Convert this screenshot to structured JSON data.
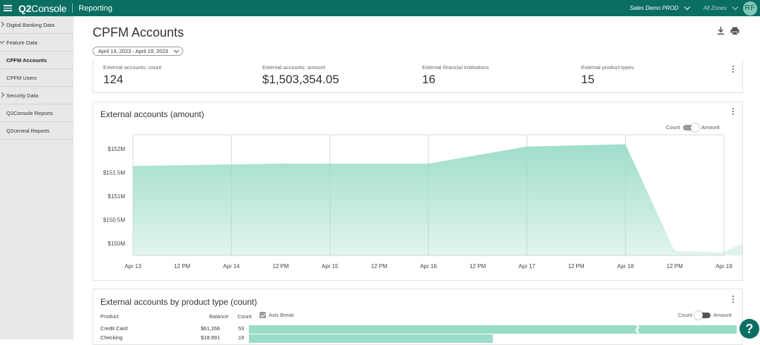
{
  "header": {
    "logo_main": "Q2",
    "logo_light": "Console",
    "section": "Reporting",
    "environment": "Sales Demo PROD",
    "zones": "All Zones",
    "avatar_initials": "RF"
  },
  "sidebar": {
    "items": [
      {
        "label": "Digital Banking Data",
        "caret": "right"
      },
      {
        "label": "Feature Data",
        "caret": "down"
      },
      {
        "label": "CPFM Accounts",
        "caret": "",
        "active": true
      },
      {
        "label": "CPFM Users",
        "caret": ""
      },
      {
        "label": "Security Data",
        "caret": "right"
      },
      {
        "label": "Q2Console Reports",
        "caret": ""
      },
      {
        "label": "Q2central Reports",
        "caret": ""
      }
    ]
  },
  "page": {
    "title": "CPFM Accounts",
    "date_range": "April 13, 2023 - April 19, 2023"
  },
  "kpis": [
    {
      "label": "External accounts: count",
      "value": "124"
    },
    {
      "label": "External accounts: amount",
      "value": "$1,503,354.05"
    },
    {
      "label": "External financial institutions",
      "value": "16"
    },
    {
      "label": "External product types",
      "value": "15"
    }
  ],
  "amount_chart": {
    "title": "External accounts (amount)",
    "toggle_left": "Count",
    "toggle_right": "Amount",
    "toggle_state": "Amount"
  },
  "chart_data": {
    "type": "area",
    "x": [
      "Apr 13",
      "12 PM",
      "Apr 14",
      "12 PM",
      "Apr 15",
      "12 PM",
      "Apr 16",
      "12 PM",
      "Apr 17",
      "12 PM",
      "Apr 18",
      "12 PM",
      "Apr 19"
    ],
    "x_hours": [
      0,
      36,
      48,
      72,
      96,
      120,
      132,
      144,
      156
    ],
    "values": [
      151.64,
      151.69,
      151.69,
      151.69,
      152.05,
      152.1,
      149.84,
      149.82,
      150.3
    ],
    "yticks": [
      "$150M",
      "$150.5M",
      "$151M",
      "$151.5M",
      "$152M"
    ],
    "ytick_values": [
      150,
      150.5,
      151,
      151.5,
      152
    ],
    "ylim": [
      149.75,
      152.3
    ],
    "unit": "$M",
    "grid": true,
    "color": "#9bdcc9"
  },
  "product_chart": {
    "title": "External accounts by product type (count)",
    "columns": [
      "Product",
      "Balance",
      "Count"
    ],
    "axis_break_label": "Axis Break",
    "toggle_left": "Count",
    "toggle_right": "Amount",
    "toggle_state": "Count",
    "rows": [
      {
        "product": "Credit Card",
        "balance": "$61,266",
        "count": "53",
        "count_value": 53
      },
      {
        "product": "Checking",
        "balance": "$18,991",
        "count": "19",
        "count_value": 19
      }
    ]
  },
  "help": {
    "label": "?"
  },
  "colors": {
    "brand": "#0b6e63",
    "area": "#9bdcc9"
  }
}
